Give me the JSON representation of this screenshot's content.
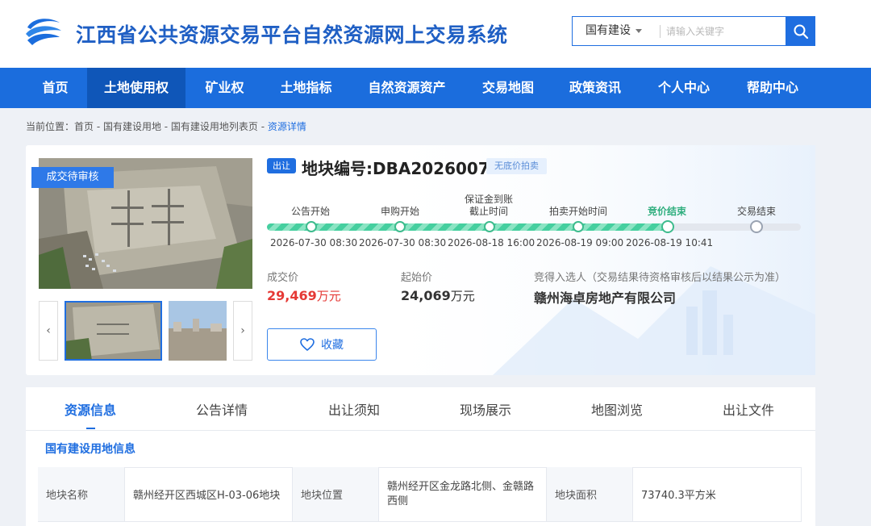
{
  "header": {
    "site_title": "江西省公共资源交易平台自然资源网上交易系统",
    "logo_icon": "wave-logo-icon",
    "search": {
      "type_selected": "国有建设",
      "placeholder": "请输入关键字",
      "button_icon": "search-icon"
    }
  },
  "nav": {
    "items": [
      {
        "label": "首页"
      },
      {
        "label": "土地使用权"
      },
      {
        "label": "矿业权"
      },
      {
        "label": "土地指标"
      },
      {
        "label": "自然资源资产"
      },
      {
        "label": "交易地图"
      },
      {
        "label": "政策资讯"
      },
      {
        "label": "个人中心"
      },
      {
        "label": "帮助中心"
      }
    ],
    "active_index": 1
  },
  "breadcrumb": {
    "prefix": "当前位置：首页 - 国有建设用地 - 国有建设用地列表页 - ",
    "current": "资源详情"
  },
  "parcel": {
    "status_badge": "成交待审核",
    "sale_tag": "出让",
    "code": "地块编号:DBA2026007",
    "method_tag": "无底价拍卖",
    "timeline": [
      {
        "label": "公告开始",
        "time": "2026-07-30 08:30",
        "done": true
      },
      {
        "label": "申购开始",
        "time": "2026-07-30 08:30",
        "done": true
      },
      {
        "label_line1": "保证金到账",
        "label_line2": "截止时间",
        "time": "2026-08-18 16:00",
        "done": true
      },
      {
        "label": "拍卖开始时间",
        "time": "2026-08-19 09:00",
        "done": true
      },
      {
        "label": "竞价结束",
        "time": "2026-08-19 10:41",
        "done": true,
        "current": true
      },
      {
        "label": "交易结束",
        "time": "",
        "done": false
      }
    ],
    "deal_price": {
      "label": "成交价",
      "value": "29,469",
      "unit": "万元"
    },
    "start_price": {
      "label": "起始价",
      "value": "24,069",
      "unit": "万元"
    },
    "winner": {
      "label": "竞得入选人（交易结果待资格审核后以结果公示为准）",
      "value": "赣州海卓房地产有限公司"
    },
    "favorite_button": {
      "label": "收藏",
      "icon": "heart-icon"
    }
  },
  "tabs": {
    "items": [
      {
        "label": "资源信息"
      },
      {
        "label": "公告详情"
      },
      {
        "label": "出让须知"
      },
      {
        "label": "现场展示"
      },
      {
        "label": "地图浏览"
      },
      {
        "label": "出让文件"
      }
    ],
    "active_index": 0
  },
  "info": {
    "section_title": "国有建设用地信息",
    "row": [
      {
        "label": "地块名称",
        "value": "赣州经开区西城区H-03-06地块"
      },
      {
        "label": "地块位置",
        "value": "赣州经开区金龙路北侧、金赣路西侧"
      },
      {
        "label": "地块面积",
        "value": "73740.3平方米"
      }
    ]
  },
  "colors": {
    "primary": "#1b6ddd",
    "nav_active": "#0f56b8",
    "progress": "#45cf9f",
    "price_red": "#e53935"
  }
}
